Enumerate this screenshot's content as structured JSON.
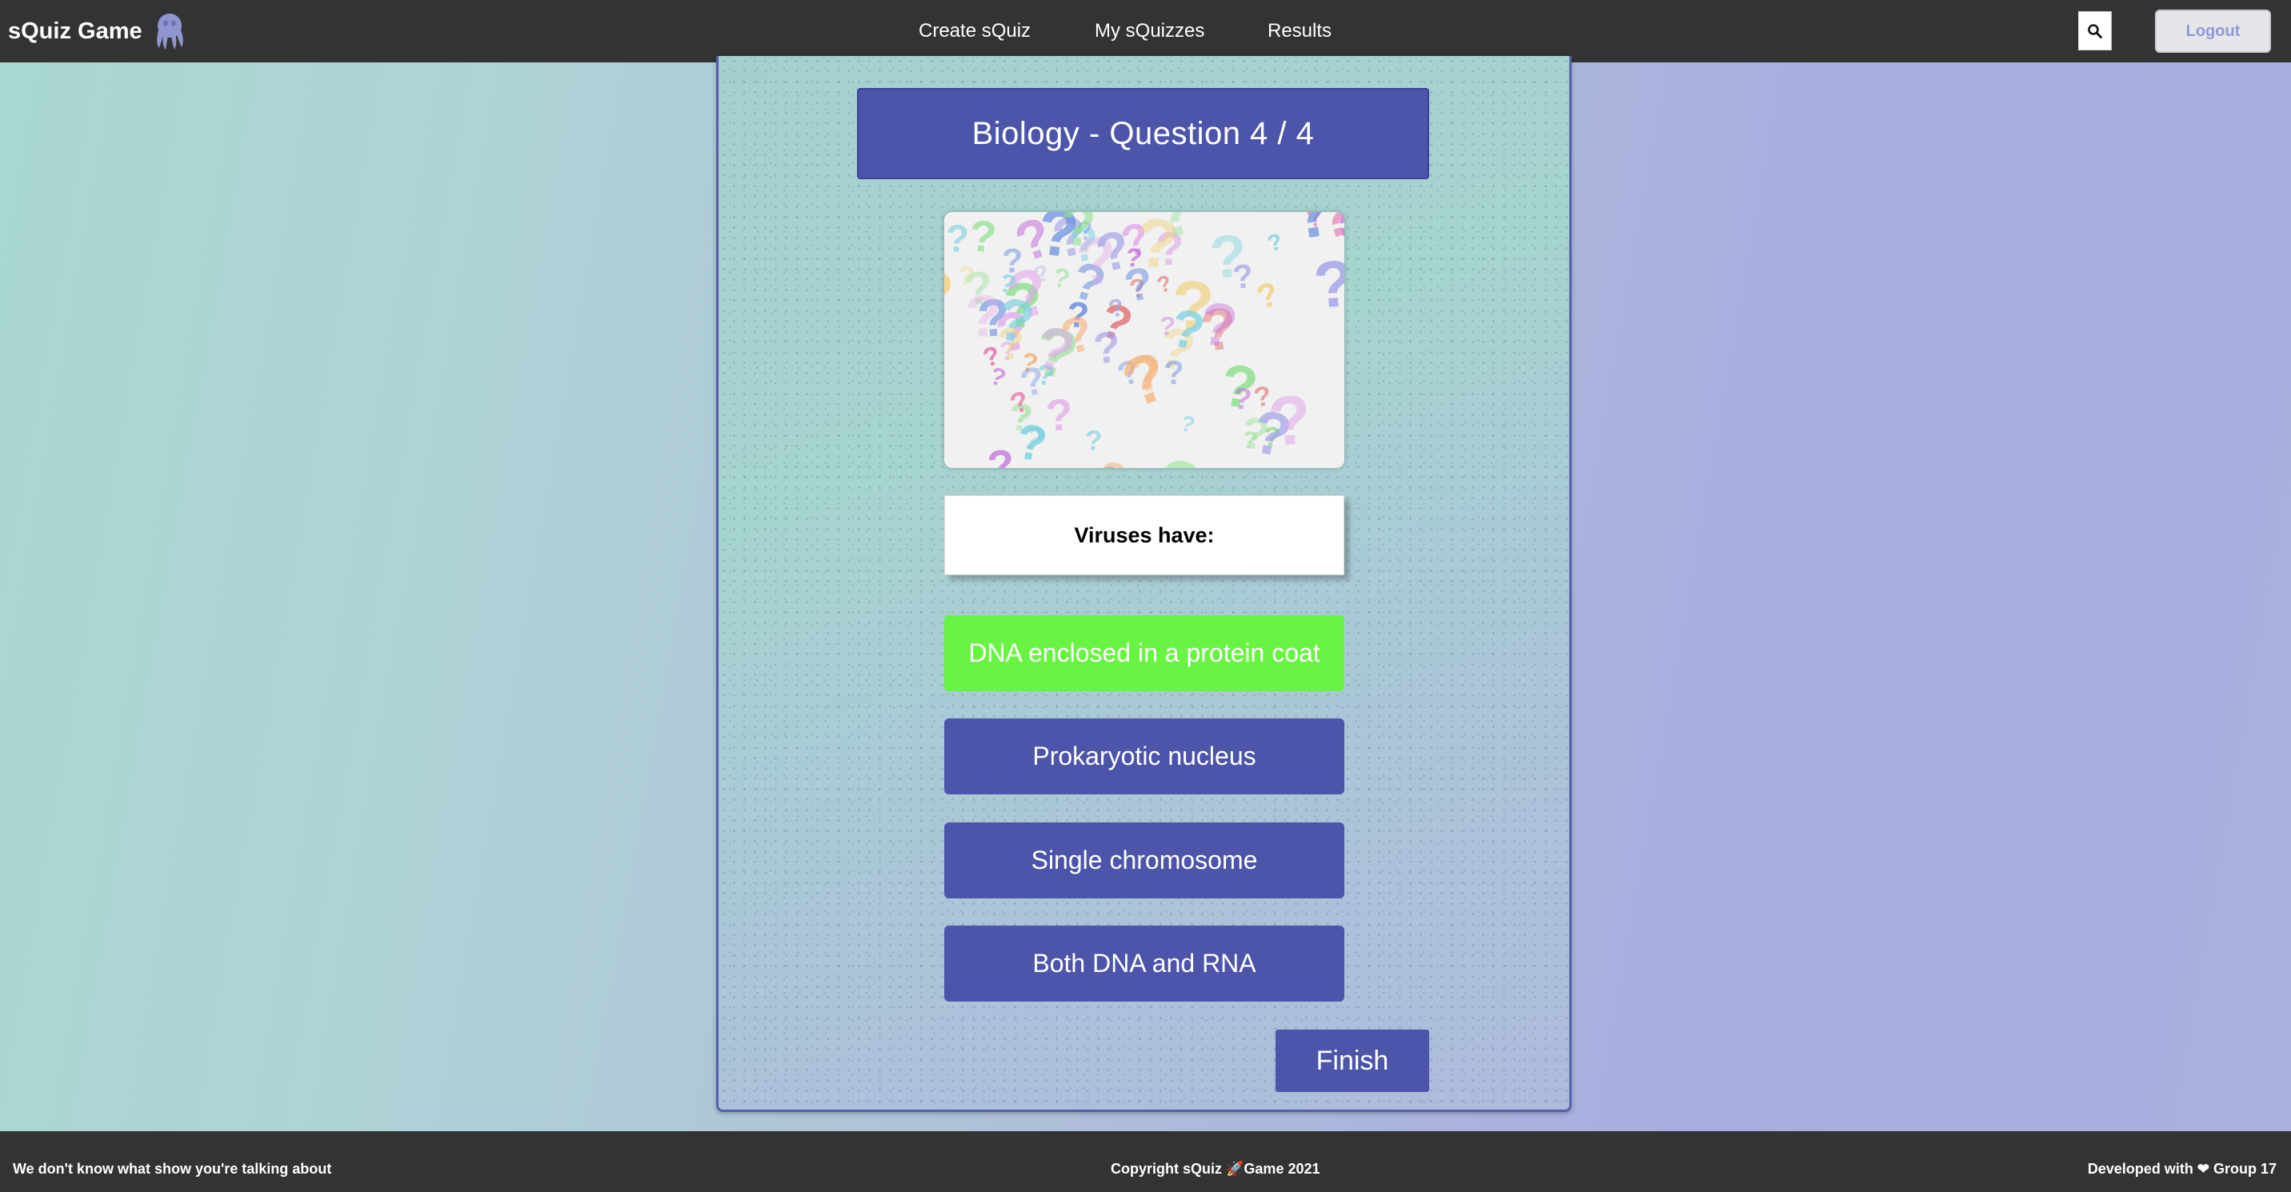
{
  "header": {
    "brand": "sQuiz Game",
    "brand_icon": "octopus-icon",
    "nav": [
      "Create sQuiz",
      "My sQuizzes",
      "Results"
    ],
    "search_icon": "search-icon",
    "logout_label": "Logout"
  },
  "quiz": {
    "title": "Biology - Question 4 / 4",
    "image_icon": "question-marks-image",
    "question": "Viruses have:",
    "answers": [
      {
        "label": "DNA enclosed in a protein coat",
        "state": "correct"
      },
      {
        "label": "Prokaryotic nucleus",
        "state": "default"
      },
      {
        "label": "Single chromosome",
        "state": "default"
      },
      {
        "label": "Both DNA and RNA",
        "state": "default"
      }
    ],
    "finish_label": "Finish"
  },
  "footer": {
    "left": "We don't know what show you're talking about",
    "center_prefix": "Copyright sQuiz ",
    "center_icon": "rocket-icon",
    "center_suffix": "Game 2021",
    "right_prefix": "Developed with ",
    "right_icon": "heart-icon",
    "right_suffix": " Group 17"
  },
  "colors": {
    "bar": "#333333",
    "primary": "#4d55aa",
    "correct": "#69f443"
  }
}
